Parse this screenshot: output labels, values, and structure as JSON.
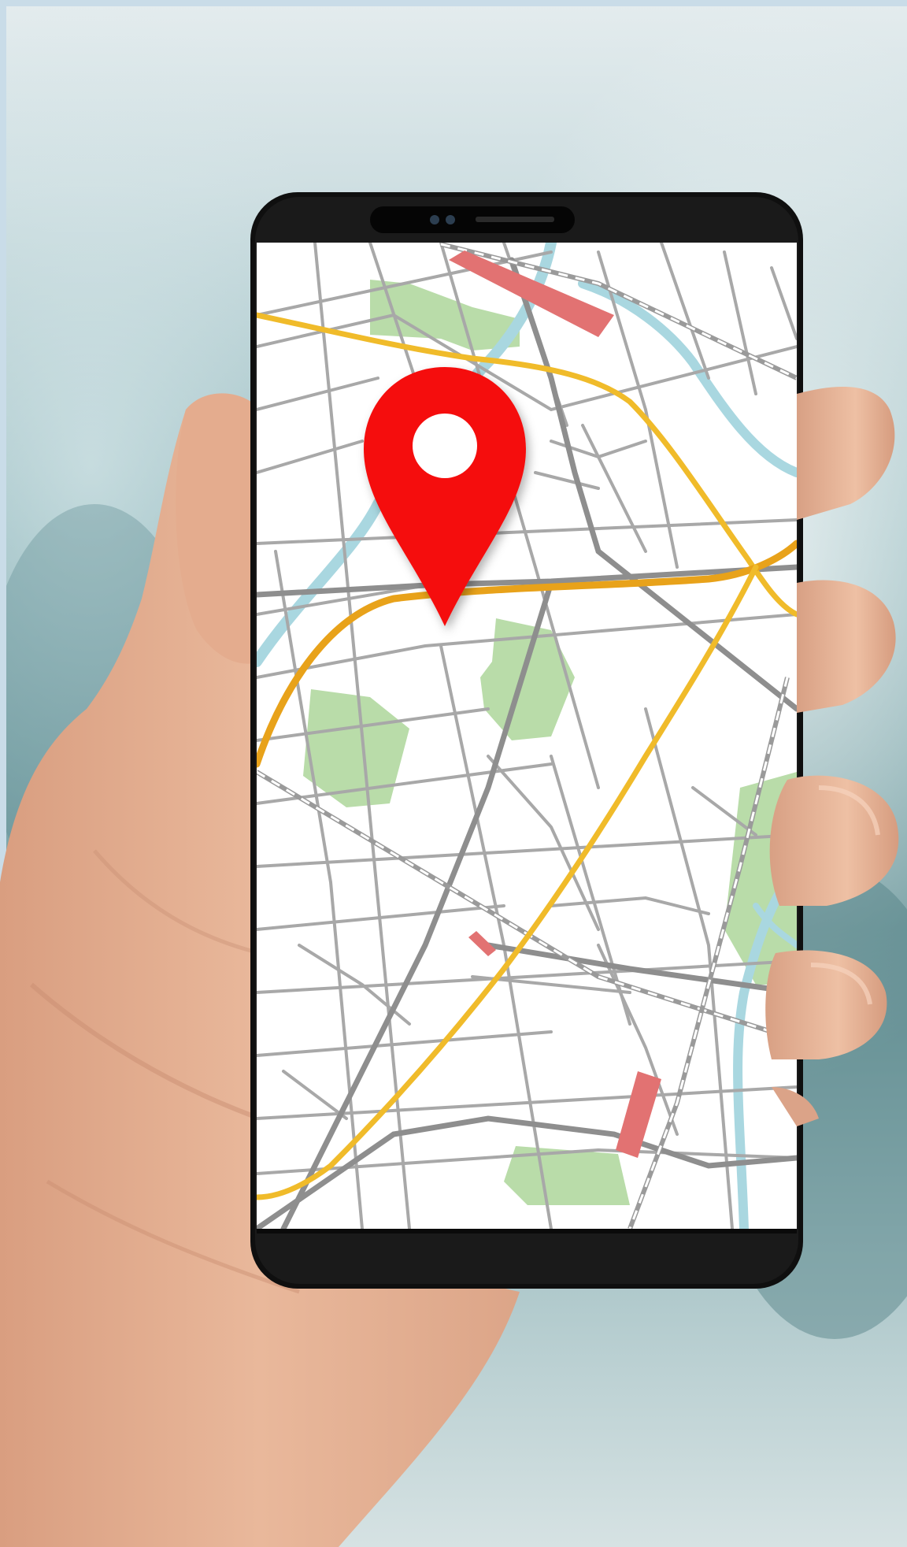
{
  "photo": {
    "subject": "hand-holding-smartphone",
    "background_colors": [
      "#dfe7ea",
      "#8fb3b8",
      "#5f8d92",
      "#c9d9dc"
    ]
  },
  "phone": {
    "body_color": "#111111",
    "screen_color": "#ffffff"
  },
  "map": {
    "colors": {
      "minor_road": "#a3a3a3",
      "major_road": "#8c8c8c",
      "highway": "#f0bb2a",
      "water": "#a9d7e0",
      "park": "#b9dca9",
      "building": "#e27272",
      "rail": "#9a9a9a"
    }
  },
  "pin": {
    "icon": "location-pin-icon",
    "color": "#f50e0e"
  },
  "skin_color": "#e7b495"
}
